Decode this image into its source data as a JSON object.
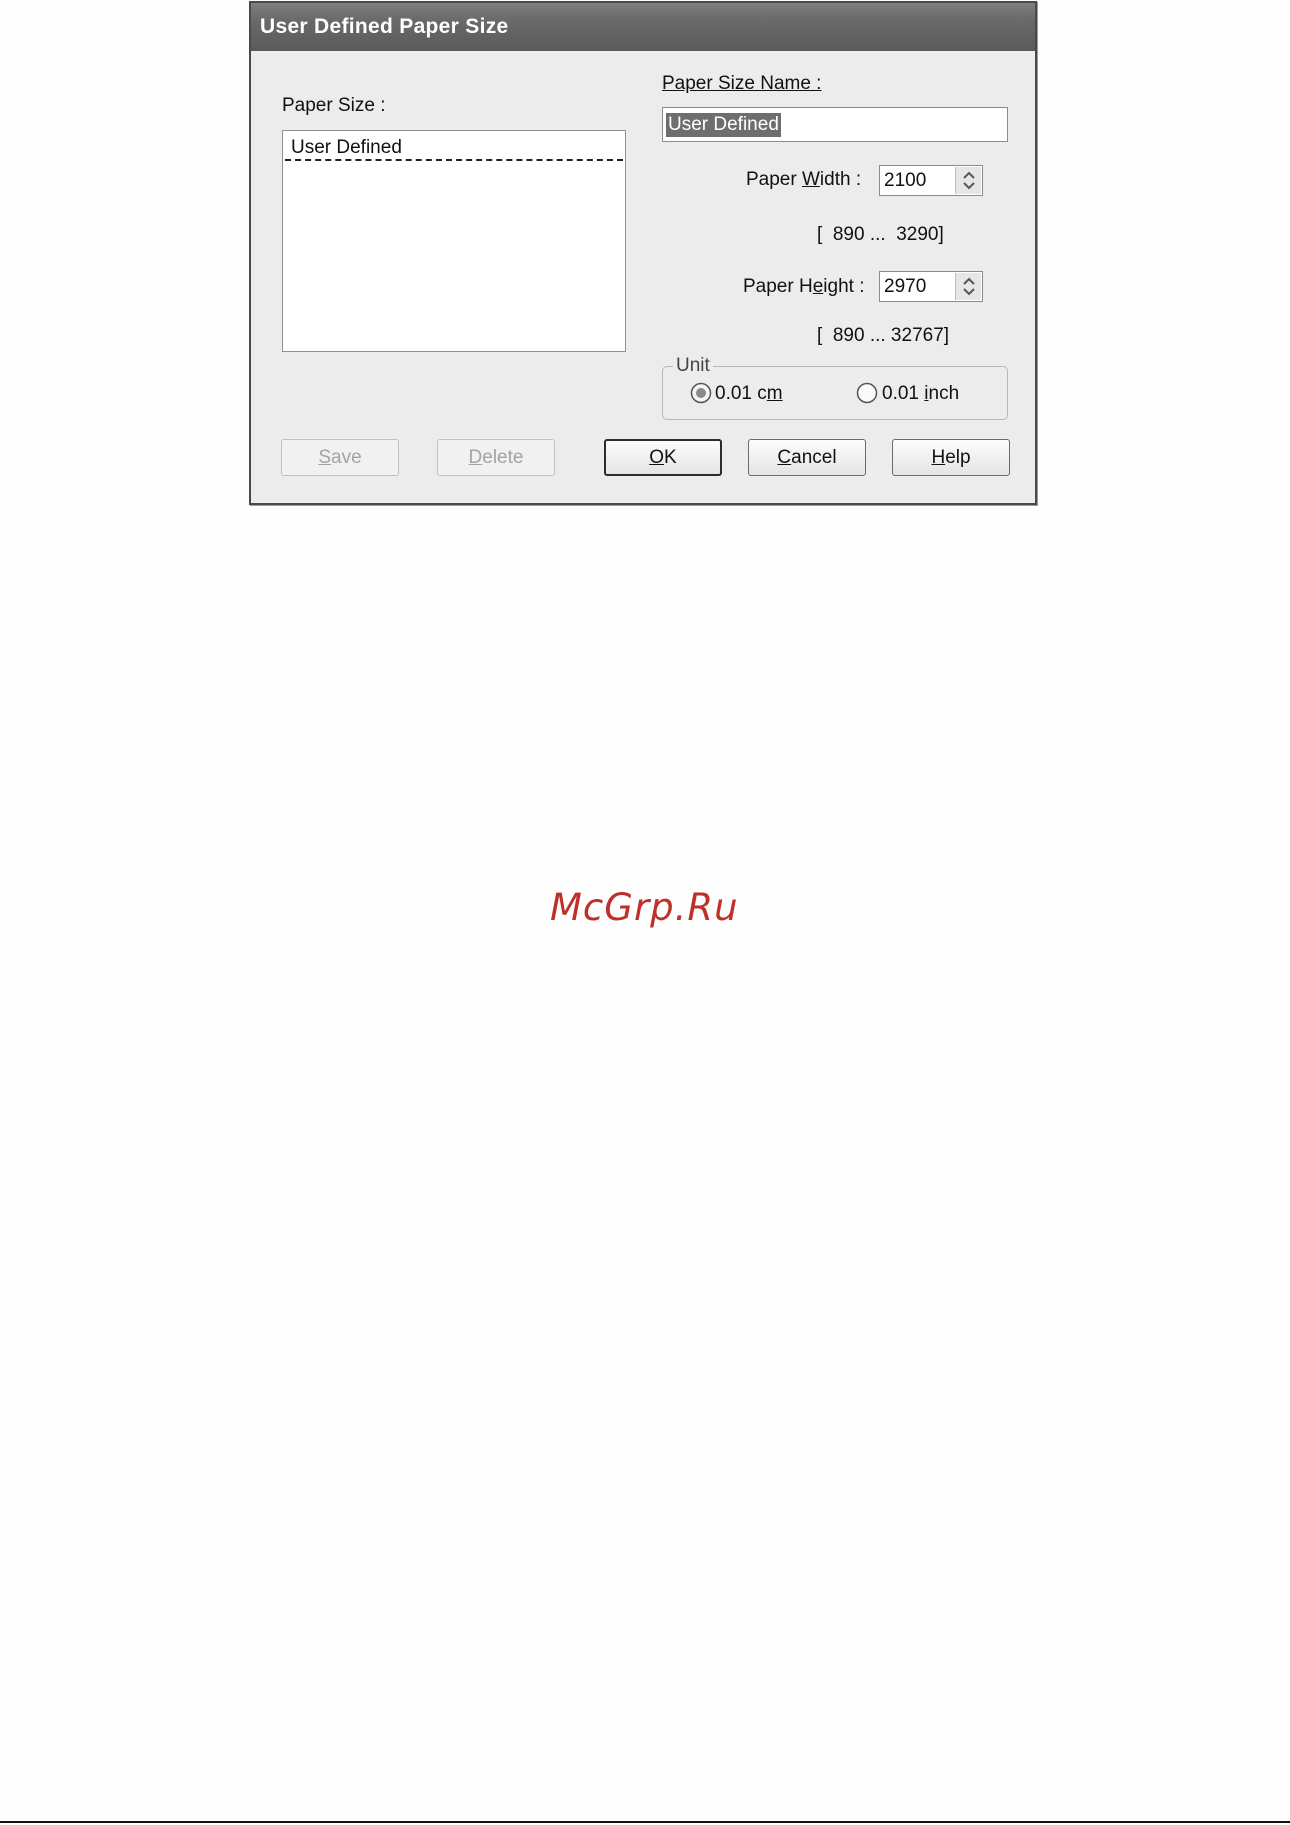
{
  "dialog": {
    "title": "User Defined Paper Size",
    "paper_size_label": "Paper Size :",
    "paper_size_items": [
      "User Defined"
    ],
    "paper_size_name_label": "Paper Size Name :",
    "paper_size_name_value": "User Defined",
    "width": {
      "label_pre": "Paper ",
      "label_u": "W",
      "label_post": "idth  :",
      "value": "2100",
      "range": "[  890 ...  3290]"
    },
    "height": {
      "label_pre": "Paper H",
      "label_u": "e",
      "label_post": "ight :",
      "value": "2970",
      "range": "[  890 ... 32767]"
    },
    "unit": {
      "title": "Unit",
      "options": [
        {
          "pre": "0.01 c",
          "u": "m",
          "post": "",
          "selected": true
        },
        {
          "pre": "0.01 ",
          "u": "i",
          "post": "nch",
          "selected": false
        }
      ]
    },
    "buttons": {
      "save": {
        "u": "S",
        "rest": "ave",
        "enabled": false
      },
      "delete": {
        "u": "D",
        "rest": "elete",
        "enabled": false
      },
      "ok": {
        "u": "O",
        "rest": "K",
        "enabled": true
      },
      "cancel": {
        "u": "C",
        "rest": "ancel",
        "enabled": true
      },
      "help": {
        "u": "H",
        "rest": "elp",
        "enabled": true
      }
    }
  },
  "watermark": "McGrp.Ru",
  "colors": {
    "dialog_bg": "#ececec",
    "titlebar": "#6a6a6a",
    "selection": "#6e6e6e",
    "watermark": "#c0302a"
  }
}
